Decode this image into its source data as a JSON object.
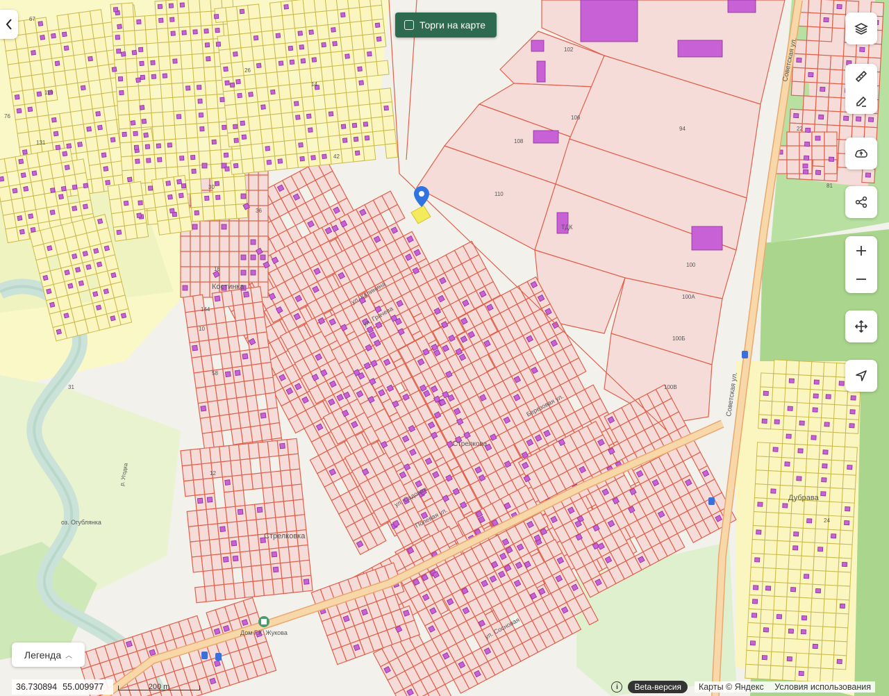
{
  "toolbar": {
    "auction_label": "Торги на карте"
  },
  "map_labels": {
    "settlements": [
      "Костинка",
      "Стрелковка",
      "Дубрава",
      "Стрелкова"
    ],
    "streets": [
      "Советская ул.",
      "ул. Калинина",
      "ул. Грачева",
      "Полевая ул.",
      "ул. Садовая",
      "Березовая ул.",
      "ул. Сосновая"
    ],
    "places": [
      "Дом Г.К. Жукова",
      "оз. Огублянка",
      "р. Угодка",
      "ТДК"
    ],
    "plot_numbers": [
      "102",
      "106",
      "108",
      "110",
      "94",
      "100",
      "100А",
      "100Б",
      "100В",
      "36",
      "144",
      "12",
      "10",
      "16",
      "30",
      "119",
      "131",
      "76",
      "67",
      "26",
      "14",
      "42",
      "58",
      "31",
      "24",
      "22",
      "81"
    ]
  },
  "controls": [
    {
      "name": "layers-icon"
    },
    {
      "name": "ruler-icon"
    },
    {
      "name": "edit-icon"
    },
    {
      "name": "upload-icon"
    },
    {
      "name": "share-icon"
    },
    {
      "name": "zoom-in-icon"
    },
    {
      "name": "zoom-out-icon"
    },
    {
      "name": "pan-icon"
    },
    {
      "name": "locate-icon"
    }
  ],
  "legend": {
    "label": "Легенда"
  },
  "status": {
    "lon": "36.730894",
    "lat": "55.009977",
    "scale": "200 m",
    "beta": "Beta-версия",
    "attribution": "Карты © Яндекс",
    "terms": "Условия использования"
  },
  "colors": {
    "parcel_red": "#e0604a",
    "parcel_yellow": "#c9b94a",
    "building": "#c860d6",
    "forest": "#a9d68c",
    "road": "#f2c68a",
    "button_green": "#2d6a4f"
  }
}
